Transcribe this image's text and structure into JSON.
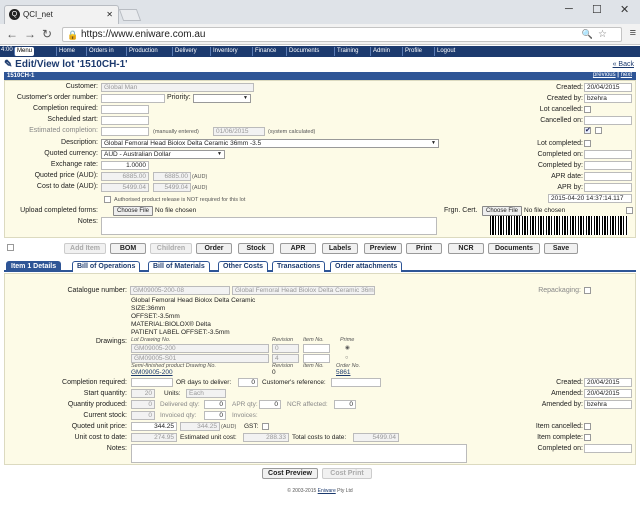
{
  "browser": {
    "tab_title": "QCI_net",
    "url": "https://www.eniware.com.au"
  },
  "nav": {
    "time": "4:00",
    "items": [
      "Menu",
      "Home",
      "Orders in",
      "Production",
      "Delivery",
      "Inventory",
      "Finance",
      "Documents",
      "Training",
      "Admin",
      "Profile",
      "Logout"
    ]
  },
  "page": {
    "title": "Edit/View lot '1510CH-1'",
    "back": "« Back",
    "lot_id": "1510CH-1",
    "previous": "previous",
    "sep": "|",
    "next": "next"
  },
  "lot": {
    "customer_label": "Customer:",
    "customer": "Global Man",
    "order_number_label": "Customer's order number:",
    "priority_label": "Priority:",
    "completion_required_label": "Completion required:",
    "scheduled_start_label": "Scheduled start:",
    "estimated_completion_label": "Estimated completion:",
    "manually_entered": "(manually entered)",
    "system_date": "01/06/2015",
    "system_calculated": "(system calculated)",
    "description_label": "Description:",
    "description": "Global Femoral Head Biolox Delta Ceramic 36mm -3.5",
    "currency_label": "Quoted currency:",
    "currency": "AUD - Australian Dollar",
    "exchange_label": "Exchange rate:",
    "exchange_rate": "1.0000",
    "quoted_price_label": "Quoted price (AUD):",
    "quoted_price_a": "6885.00",
    "quoted_price_b": "6885.00",
    "quoted_price_unit": "(AUD)",
    "cost_label": "Cost to date (AUD):",
    "cost_a": "5499.04",
    "cost_b": "5499.04",
    "cost_unit": "(AUD)",
    "authorised_text": "Authorised product release is NOT required for this lot",
    "upload_label": "Upload completed forms:",
    "choose_file": "Choose File",
    "no_file": "No file chosen",
    "notes_label": "Notes:",
    "frgn_cert_label": "Frgn. Cert.",
    "created_label": "Created:",
    "created": "20/04/2015",
    "created_by_label": "Created by:",
    "created_by": "bzehra",
    "lot_cancelled_label": "Lot cancelled:",
    "cancelled_on_label": "Cancelled on:",
    "lot_completed_label": "Lot completed:",
    "completed_on_label": "Completed on:",
    "completed_by_label": "Completed by:",
    "apr_date_label": "APR date:",
    "apr_by_label": "APR by:",
    "timestamp": "2015-04-20 14:37:14.117"
  },
  "actions": [
    "Add Item",
    "BOM",
    "Children",
    "Order",
    "Stock",
    "APR",
    "Labels",
    "Preview",
    "Print",
    "NCR",
    "Documents",
    "Save"
  ],
  "tabs": [
    "Item 1 Details",
    "Bill of Operations",
    "Bill of Materials",
    "Other Costs",
    "Transactions",
    "Order attachments"
  ],
  "item": {
    "catalogue_label": "Catalogue number:",
    "catalogue": "GM09005-200-08",
    "catalogue_desc": "Global Femoral Head Biolox Delta Ceramic 36mm -3.",
    "repackaging_label": "Repackaging:",
    "desc_lines": [
      "Global Femoral Head Biolox Delta Ceramic",
      "SIZE:36mm",
      "OFFSET:-3.5mm",
      "MATERIAL:BIOLOX® Delta",
      "PATIENT LABEL OFFSET:-3.5mm"
    ],
    "drawings_label": "Drawings:",
    "lot_drawing_no": "Lot Drawing No.",
    "revision": "Revision",
    "item_no": "Item No.",
    "prime": "Prime",
    "drawing1": "GM09005-200",
    "drawing1_rev": "0",
    "drawing2": "GM09005-S01",
    "drawing2_rev": "4",
    "semi_label": "Semi-finished product Drawing No.",
    "order_no": "Order No.",
    "semi_drawing": "GM09005-200",
    "semi_rev": "0",
    "semi_order": "5861",
    "completion_label": "Completion required:",
    "or_days": "OR days to deliver:",
    "days_value": "0",
    "cust_ref_label": "Customer's reference:",
    "start_qty_label": "Start quantity:",
    "start_qty": "20",
    "units_label": "Units:",
    "units": "Each",
    "qty_produced_label": "Quantity produced:",
    "qty_produced": "0",
    "delivered_label": "Delivered qty:",
    "delivered": "0",
    "apr_qty_label": "APR qty:",
    "apr_qty": "0",
    "ncr_label": "NCR affected:",
    "ncr": "0",
    "current_stock_label": "Current stock:",
    "current_stock": "0",
    "invoiced_label": "Invoiced qty:",
    "invoiced": "0",
    "invoices_label": "Invoices:",
    "quoted_unit_label": "Quoted unit price:",
    "quoted_unit_a": "344.25",
    "quoted_unit_b": "344.25",
    "quoted_unit_unit": "(AUD)",
    "gst_label": "GST:",
    "unit_cost_label": "Unit cost to date:",
    "unit_cost": "274.95",
    "est_unit_label": "Estimated unit cost:",
    "est_unit": "288.33",
    "total_costs_label": "Total costs to date:",
    "total_costs": "5499.04",
    "notes_label": "Notes:",
    "created_label": "Created:",
    "created": "20/04/2015",
    "amended_label": "Amended:",
    "amended": "20/04/2015",
    "amended_by_label": "Amended by:",
    "amended_by": "bzehra",
    "item_cancelled_label": "Item cancelled:",
    "item_complete_label": "Item complete:",
    "completed_on_label": "Completed on:"
  },
  "bottom": {
    "cost_preview": "Cost Preview",
    "cost_print": "Cost Print"
  },
  "footer": {
    "text": "© 2003-2015",
    "company": "Eniware",
    "suffix": "Pty Ltd"
  }
}
